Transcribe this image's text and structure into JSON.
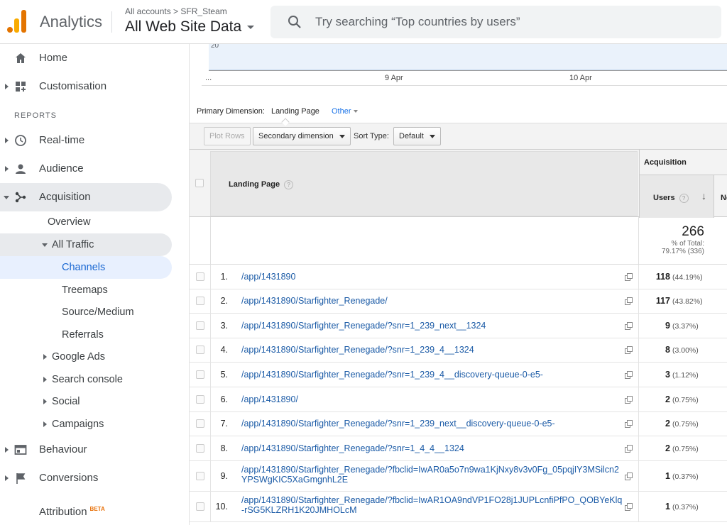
{
  "header": {
    "brand": "Analytics",
    "crumb_all_accounts": "All accounts",
    "crumb_sep": ">",
    "crumb_account": "SFR_Steam",
    "property": "All Web Site Data",
    "search_placeholder": "Try searching “Top countries by users”"
  },
  "colors": {
    "logo_orange": "#f9ab00",
    "logo_dark": "#e37400",
    "link": "#1a5aa6",
    "selected_nav": "#1967d2"
  },
  "sidebar": {
    "home": "Home",
    "customisation": "Customisation",
    "reports_label": "REPORTS",
    "realtime": "Real-time",
    "audience": "Audience",
    "acquisition": "Acquisition",
    "overview": "Overview",
    "all_traffic": "All Traffic",
    "channels": "Channels",
    "treemaps": "Treemaps",
    "source_medium": "Source/Medium",
    "referrals": "Referrals",
    "google_ads": "Google Ads",
    "search_console": "Search console",
    "social": "Social",
    "campaigns": "Campaigns",
    "behaviour": "Behaviour",
    "conversions": "Conversions",
    "attribution": "Attribution",
    "beta": "BETA"
  },
  "chart": {
    "y_tick": "20",
    "x_start": "...",
    "x_tick_1": "9 Apr",
    "x_tick_2": "10 Apr"
  },
  "dimension": {
    "label": "Primary Dimension:",
    "selected": "Landing Page",
    "other": "Other"
  },
  "toolbar": {
    "plot_rows": "Plot Rows",
    "secondary_dimension": "Secondary dimension",
    "sort_type_label": "Sort Type:",
    "sort_type_value": "Default"
  },
  "table": {
    "col_landing_page": "Landing Page",
    "group_acquisition": "Acquisition",
    "col_users": "Users",
    "col_new_partial": "Ne",
    "help": "?",
    "sort_arrow": "↓",
    "total_users": "266",
    "total_pct_line1": "% of Total:",
    "total_pct_line2": "79.17% (336)",
    "rows": [
      {
        "idx": "1.",
        "page": "/app/1431890",
        "users": "118",
        "pct": "(44.19%)"
      },
      {
        "idx": "2.",
        "page": "/app/1431890/Starfighter_Renegade/",
        "users": "117",
        "pct": "(43.82%)"
      },
      {
        "idx": "3.",
        "page": "/app/1431890/Starfighter_Renegade/?snr=1_239_next__1324",
        "users": "9",
        "pct": "(3.37%)"
      },
      {
        "idx": "4.",
        "page": "/app/1431890/Starfighter_Renegade/?snr=1_239_4__1324",
        "users": "8",
        "pct": "(3.00%)"
      },
      {
        "idx": "5.",
        "page": "/app/1431890/Starfighter_Renegade/?snr=1_239_4__discovery-queue-0-e5-",
        "users": "3",
        "pct": "(1.12%)"
      },
      {
        "idx": "6.",
        "page": "/app/1431890/",
        "users": "2",
        "pct": "(0.75%)"
      },
      {
        "idx": "7.",
        "page": "/app/1431890/Starfighter_Renegade/?snr=1_239_next__discovery-queue-0-e5-",
        "users": "2",
        "pct": "(0.75%)"
      },
      {
        "idx": "8.",
        "page": "/app/1431890/Starfighter_Renegade/?snr=1_4_4__1324",
        "users": "2",
        "pct": "(0.75%)"
      },
      {
        "idx": "9.",
        "page": "/app/1431890/Starfighter_Renegade/?fbclid=IwAR0a5o7n9wa1KjNxy8v3v0Fg_05pqjIY3MSilcn2YPSWgKIC5XaGmgnhL2E",
        "users": "1",
        "pct": "(0.37%)"
      },
      {
        "idx": "10.",
        "page": "/app/1431890/Starfighter_Renegade/?fbclid=IwAR1OA9ndVP1FO28j1JUPLcnfiPfPO_QOBYeKlq-rSG5KLZRH1K20JMHOLcM",
        "users": "1",
        "pct": "(0.37%)"
      }
    ]
  }
}
